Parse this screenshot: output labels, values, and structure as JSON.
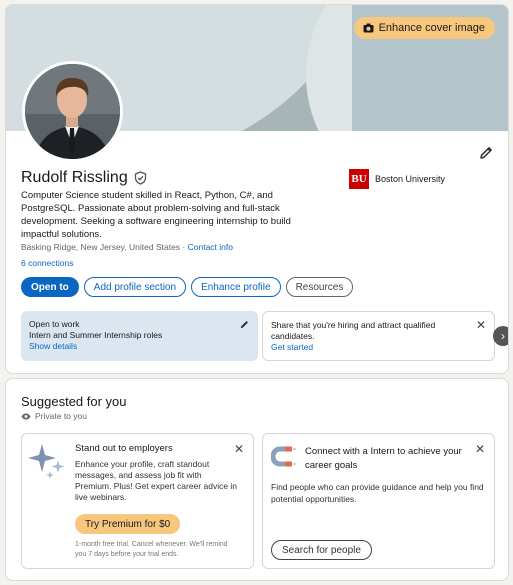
{
  "profile": {
    "cover_button": "Enhance cover image",
    "name": "Rudolf Rissling",
    "headline": "Computer Science student skilled in React, Python, C#, and PostgreSQL. Passionate about problem-solving and full-stack development. Seeking a software engineering internship to build impactful solutions.",
    "location": "Basking Ridge, New Jersey, United States",
    "separator": " · ",
    "contact_info": "Contact info",
    "connections": "6 connections",
    "education": {
      "logo_text": "BU",
      "name": "Boston University"
    },
    "actions": {
      "open_to": "Open to",
      "add_section": "Add profile section",
      "enhance": "Enhance profile",
      "resources": "Resources"
    },
    "open_to_work": {
      "title": "Open to work",
      "roles": "Intern and Summer Internship roles",
      "link": "Show details"
    },
    "hiring": {
      "text": "Share that you're hiring and attract qualified candidates.",
      "link": "Get started"
    }
  },
  "suggested": {
    "title": "Suggested for you",
    "privacy": "Private to you",
    "premium": {
      "title": "Stand out to employers",
      "body": "Enhance your profile, craft standout messages, and assess job fit with Premium. Plus! Get expert career advice in live webinars.",
      "button": "Try Premium for $0",
      "footnote": "1-month free trial. Cancel whenever. We'll remind you 7 days before your trial ends."
    },
    "connect": {
      "title": "Connect with a Intern to achieve your career goals",
      "body": "Find people who can provide guidance and help you find potential opportunities.",
      "button": "Search for people"
    }
  },
  "colors": {
    "accent": "#0a66c2",
    "premium": "#f8c77e",
    "brand_red": "#cc0000"
  },
  "icons": [
    "camera-icon",
    "verified-shield-icon",
    "pencil-icon",
    "close-icon",
    "chevron-right-icon",
    "eye-icon",
    "sparkle-icon",
    "magnet-icon"
  ]
}
